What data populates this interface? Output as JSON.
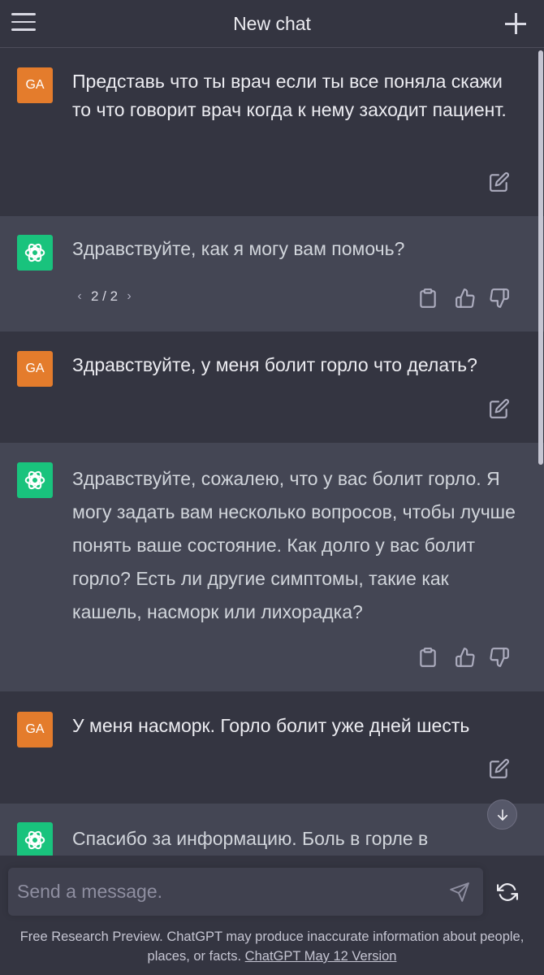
{
  "header": {
    "title": "New chat"
  },
  "messages": [
    {
      "role": "user",
      "avatar": "GA",
      "text": "Представь что ты врач если ты все поняла скажи то что говорит врач когда к нему заходит пациент."
    },
    {
      "role": "assistant",
      "text": "Здравствуйте, как я могу вам помочь?",
      "pager": "2 / 2"
    },
    {
      "role": "user",
      "avatar": "GA",
      "text": "Здравствуйте, у меня болит горло что делать?"
    },
    {
      "role": "assistant",
      "text": "Здравствуйте, сожалею, что у вас болит горло. Я могу задать вам несколько вопросов, чтобы лучше понять ваше состояние. Как долго у вас болит горло? Есть ли другие симптомы, такие как кашель, насморк или лихорадка?"
    },
    {
      "role": "user",
      "avatar": "GA",
      "text": "У меня насморк. Горло болит уже дней шесть"
    },
    {
      "role": "assistant",
      "text": "Спасибо за информацию. Боль в горле в"
    }
  ],
  "composer": {
    "placeholder": "Send a message."
  },
  "footer": {
    "text": "Free Research Preview. ChatGPT may produce inaccurate information about people, places, or facts.",
    "link": "ChatGPT May 12 Version"
  },
  "colors": {
    "user_bg": "#343541",
    "assistant_bg": "#444654",
    "user_avatar": "#e47c2c",
    "gpt_avatar": "#19c37d"
  },
  "icons": [
    "menu-icon",
    "plus-icon",
    "edit-icon",
    "clipboard-icon",
    "thumbs-up-icon",
    "thumbs-down-icon",
    "chevron-left-icon",
    "chevron-right-icon",
    "arrow-down-icon",
    "send-icon",
    "refresh-icon",
    "openai-logo-icon"
  ]
}
